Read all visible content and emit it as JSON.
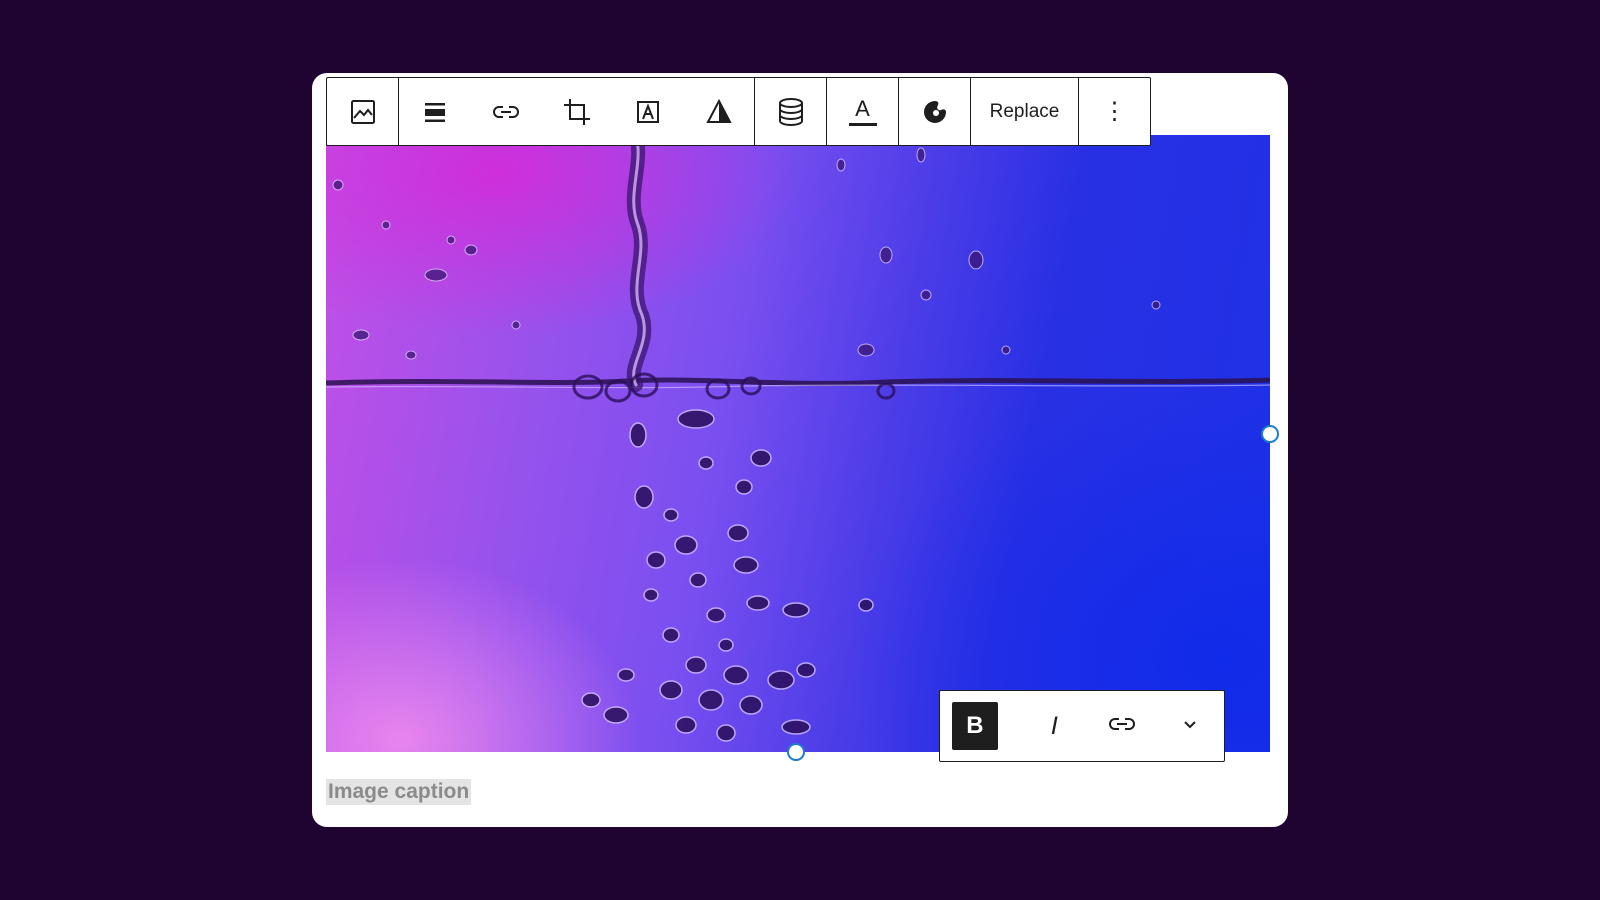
{
  "block_toolbar": {
    "items": [
      {
        "icon": "image-icon"
      },
      {
        "icon": "align-icon"
      },
      {
        "icon": "link-icon"
      },
      {
        "icon": "crop-icon"
      },
      {
        "icon": "text-overlay-icon"
      },
      {
        "icon": "duotone-icon"
      },
      {
        "icon": "database-icon"
      },
      {
        "icon": "text-color-icon",
        "glyph": "A"
      },
      {
        "icon": "palette-icon"
      }
    ],
    "replace_label": "Replace",
    "more_glyph": "⋮"
  },
  "format_toolbar": {
    "bold_label": "B",
    "italic_label": "I",
    "link_icon": "link-icon",
    "more_icon": "chevron-down-icon"
  },
  "caption": {
    "text": "Image caption"
  },
  "colors": {
    "background": "#1f0431",
    "handle_border": "#1a7bd1",
    "toolbar_text": "#1e1e1e",
    "caption_text": "#8b8b8b",
    "caption_highlight": "#e4e4e4"
  }
}
